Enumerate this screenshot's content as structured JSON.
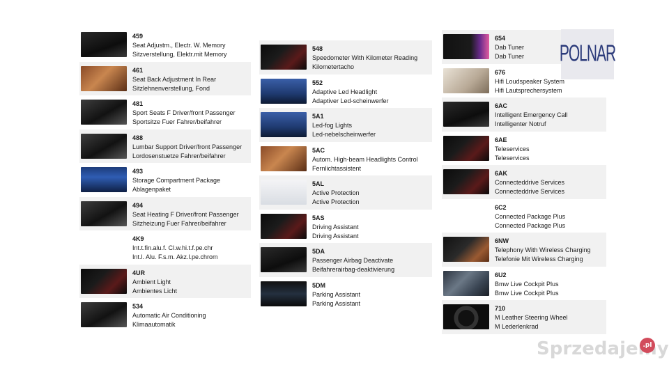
{
  "columns": [
    {
      "items": [
        {
          "code": "459",
          "line1": "Seat Adjustm., Electr. W. Memory",
          "line2": "Sitzverstellung, Elektr.mit Memory",
          "icon": "door-panel-photo"
        },
        {
          "code": "461",
          "line1": "Seat Back Adjustment In Rear",
          "line2": "Sitzlehnenverstellung, Fond",
          "icon": "rear-seats-photo"
        },
        {
          "code": "481",
          "line1": "Sport Seats F Driver/front Passenger",
          "line2": "Sportsitze Fuer Fahrer/beifahrer",
          "icon": "sport-seats-photo"
        },
        {
          "code": "488",
          "line1": "Lumbar Support Driver/front Passenger",
          "line2": "Lordosenstuetze Fahrer/beifahrer",
          "icon": "seat-controls-photo"
        },
        {
          "code": "493",
          "line1": "Storage Compartment Package",
          "line2": "Ablagenpaket",
          "icon": "trunk-photo"
        },
        {
          "code": "494",
          "line1": "Seat Heating F Driver/front Passenger",
          "line2": "Sitzheizung Fuer Fahrer/beifahrer",
          "icon": "climate-panel-photo"
        },
        {
          "code": "4K9",
          "line1": "Int.t.fin.alu.f. Cl.w.hi.t.f.pe.chr",
          "line2": "Int.l. Alu. F.s.m. Akz.l.pe.chrom",
          "icon": "none"
        },
        {
          "code": "4UR",
          "line1": "Ambient Light",
          "line2": "Ambientes Licht",
          "icon": "ambient-light-photo"
        },
        {
          "code": "534",
          "line1": "Automatic Air Conditioning",
          "line2": "Klimaautomatik",
          "icon": "air-conditioning-photo"
        }
      ]
    },
    {
      "items": [
        {
          "code": "548",
          "line1": "Speedometer With Kilometer Reading",
          "line2": "Kilometertacho",
          "icon": "speedometer-photo"
        },
        {
          "code": "552",
          "line1": "Adaptive Led Headlight",
          "line2": "Adaptiver Led-scheinwerfer",
          "icon": "headlight-photo"
        },
        {
          "code": "5A1",
          "line1": "Led-fog Lights",
          "line2": "Led-nebelscheinwerfer",
          "icon": "fog-light-photo"
        },
        {
          "code": "5AC",
          "line1": "Autom. High-beam Headlights Control",
          "line2": "Fernlichtassistent",
          "icon": "high-beam-photo"
        },
        {
          "code": "5AL",
          "line1": "Active Protection",
          "line2": "Active Protection",
          "icon": "active-protection-photo"
        },
        {
          "code": "5AS",
          "line1": "Driving Assistant",
          "line2": "Driving Assistant",
          "icon": "driving-assistant-photo"
        },
        {
          "code": "5DA",
          "line1": "Passenger Airbag Deactivate",
          "line2": "Beifahrerairbag-deaktivierung",
          "icon": "airbag-switch-photo"
        },
        {
          "code": "5DM",
          "line1": "Parking Assistant",
          "line2": "Parking Assistant",
          "icon": "parking-camera-photo"
        }
      ]
    },
    {
      "items": [
        {
          "code": "654",
          "line1": "Dab Tuner",
          "line2": "Dab Tuner",
          "icon": "dab-screen-photo"
        },
        {
          "code": "676",
          "line1": "Hifi Loudspeaker System",
          "line2": "Hifi Lautsprechersystem",
          "icon": "speaker-photo"
        },
        {
          "code": "6AC",
          "line1": "Intelligent Emergency Call",
          "line2": "Intelligenter Notruf",
          "icon": "emergency-call-photo"
        },
        {
          "code": "6AE",
          "line1": "Teleservices",
          "line2": "Teleservices",
          "icon": "teleservices-photo"
        },
        {
          "code": "6AK",
          "line1": "Connecteddrive Services",
          "line2": "Connecteddrive Services",
          "icon": "connecteddrive-photo"
        },
        {
          "code": "6C2",
          "line1": "Connected Package Plus",
          "line2": "Connected Package Plus",
          "icon": "none"
        },
        {
          "code": "6NW",
          "line1": "Telephony With Wireless Charging",
          "line2": "Telefonie Mit Wireless Charging",
          "icon": "wireless-charging-photo"
        },
        {
          "code": "6U2",
          "line1": "Bmw Live Cockpit Plus",
          "line2": "Bmw Live Cockpit Plus",
          "icon": "live-cockpit-photo"
        },
        {
          "code": "710",
          "line1": "M Leather Steering Wheel",
          "line2": "M Lederlenkrad",
          "icon": "steering-wheel-photo"
        }
      ]
    }
  ],
  "logo": {
    "text": "POLNAR"
  },
  "watermark": {
    "text": "Sprzedajemy",
    "suffix": ".pl"
  }
}
